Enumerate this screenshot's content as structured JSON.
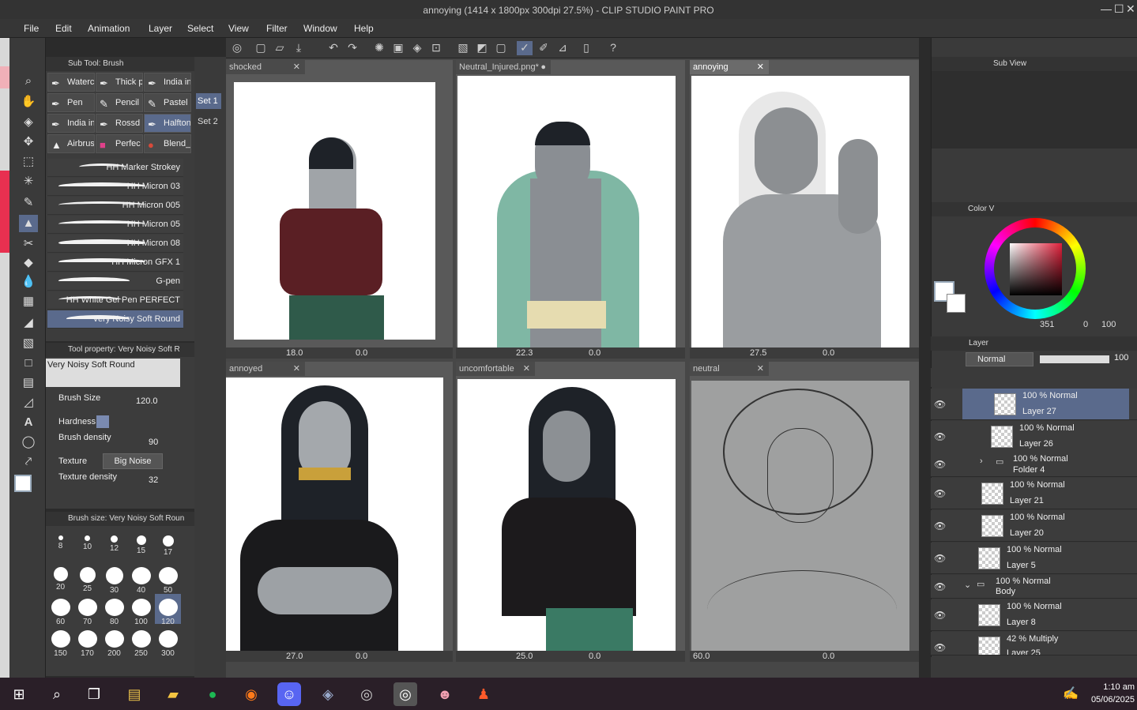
{
  "window": {
    "title": "annoying (1414 x 1800px 300dpi 27.5%)  - CLIP STUDIO PAINT PRO",
    "minimize": "—",
    "maximize": "☐",
    "close": "✕"
  },
  "menu": [
    "File",
    "Edit",
    "Animation",
    "Layer",
    "Select",
    "View",
    "Filter",
    "Window",
    "Help"
  ],
  "subtool": {
    "header": "Sub Tool: Brush",
    "buttons": [
      [
        "Waterc",
        "Thick p",
        "India in"
      ],
      [
        "Pen",
        "Pencil",
        "Pastel"
      ],
      [
        "India in",
        "Rossd",
        "Halfton"
      ],
      [
        "Airbrus",
        "Perfec",
        "Blend_"
      ]
    ],
    "brushes": [
      "HH Marker Strokey",
      "HH Micron 03",
      "HH Micron 005",
      "HH Micron 05",
      "HH Micron 08",
      "HH Micron GFX 1",
      "G-pen",
      "HH White Gel Pen PERFECT",
      "Very Noisy Soft Round"
    ]
  },
  "sets": [
    "Set 1",
    "Set 2"
  ],
  "toolprop": {
    "header": "Tool property: Very Noisy Soft R",
    "brush_name": "Very Noisy Soft Round",
    "brush_size_label": "Brush Size",
    "brush_size": "120.0",
    "hardness_label": "Hardness",
    "density_label": "Brush density",
    "density": "90",
    "texture_label": "Texture",
    "texture": "Big Noise",
    "texture_density_label": "Texture density",
    "texture_density": "32"
  },
  "brushsize": {
    "header": "Brush size: Very Noisy Soft Roun",
    "sizes": [
      "8",
      "10",
      "12",
      "15",
      "17",
      "20",
      "25",
      "30",
      "40",
      "50",
      "60",
      "70",
      "80",
      "100",
      "120",
      "150",
      "170",
      "200",
      "250",
      "300"
    ]
  },
  "views": [
    {
      "tab": "shocked",
      "zoom": "18.0",
      "angle": "0.0"
    },
    {
      "tab": "Neutral_Injured.png*",
      "zoom": "22.3",
      "angle": "0.0"
    },
    {
      "tab": "annoying",
      "zoom": "27.5",
      "angle": "0.0"
    },
    {
      "tab": "annoyed",
      "zoom": "27.0",
      "angle": "0.0"
    },
    {
      "tab": "uncomfortable",
      "zoom": "25.0",
      "angle": "0.0"
    },
    {
      "tab": "neutral",
      "zoom": "60.0",
      "angle": "0.0"
    }
  ],
  "subview": {
    "header": "Sub View"
  },
  "color": {
    "header": "Color V",
    "readout_a": "351",
    "readout_b": "0",
    "readout_c": "100"
  },
  "layerpanel": {
    "header": "Layer",
    "blend": "Normal",
    "opacity": "100",
    "layers": [
      {
        "mode": "100 % Normal",
        "name": "Layer 27"
      },
      {
        "mode": "100 % Normal",
        "name": "Layer 26"
      },
      {
        "mode": "100 % Normal",
        "name": "Folder 4"
      },
      {
        "mode": "100 % Normal",
        "name": "Layer 21"
      },
      {
        "mode": "100 % Normal",
        "name": "Layer 20"
      },
      {
        "mode": "100 % Normal",
        "name": "Layer 5"
      },
      {
        "mode": "100 % Normal",
        "name": "Body"
      },
      {
        "mode": "100 % Normal",
        "name": "Layer 8"
      },
      {
        "mode": "42 % Multiply",
        "name": "Layer 25"
      }
    ]
  },
  "taskbar": {
    "time": "1:10 am",
    "date": "05/06/2025"
  }
}
